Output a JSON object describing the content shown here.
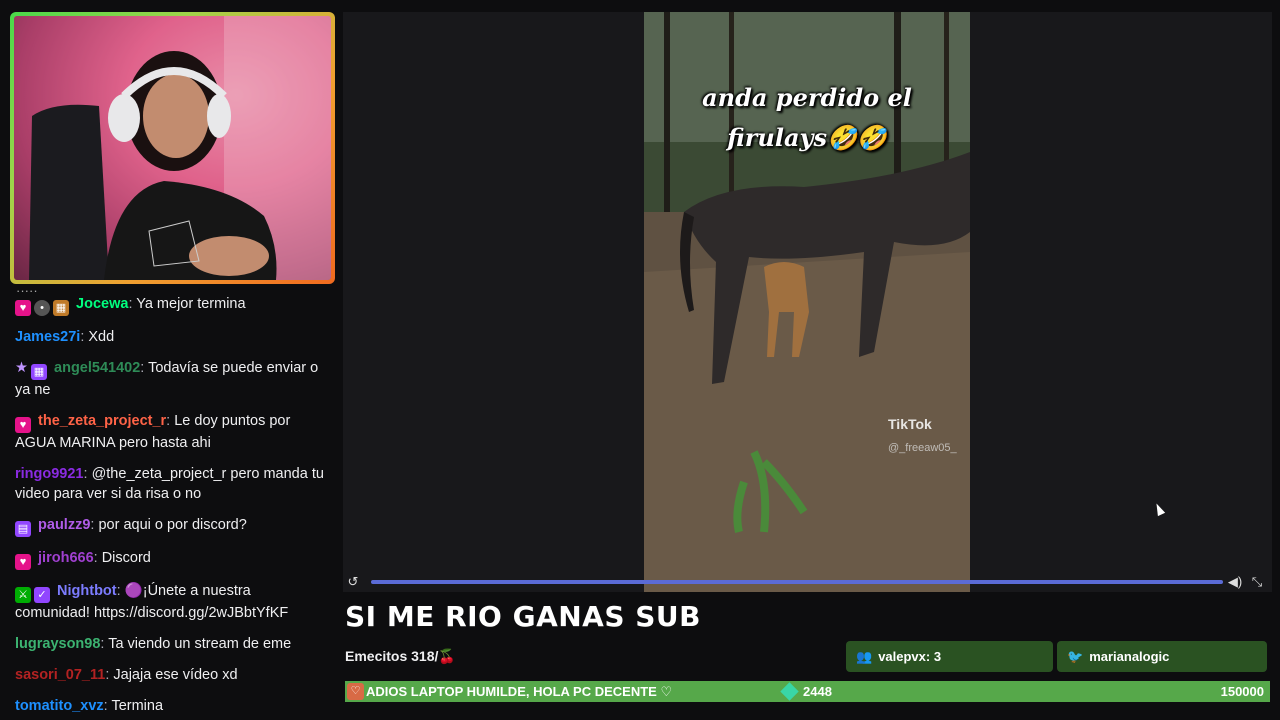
{
  "chat": {
    "messages": [
      {
        "user": "Jocewa",
        "color": "#00ff7f",
        "badges": [
          "heart",
          "mouse",
          "lock"
        ],
        "text": "Ya mejor termina"
      },
      {
        "user": "James27i",
        "color": "#1e90ff",
        "badges": [],
        "text": "Xdd"
      },
      {
        "user": "angel541402",
        "color": "#2e8b57",
        "badges": [
          "star",
          "grid"
        ],
        "text": "Todavía se puede enviar o ya ne"
      },
      {
        "user": "the_zeta_project_r",
        "color": "#ff6347",
        "badges": [
          "heart"
        ],
        "text": "Le doy puntos por AGUA MARINA pero hasta ahi"
      },
      {
        "user": "ringo9921",
        "color": "#8a2be2",
        "badges": [],
        "text": "@the_zeta_project_r pero manda tu video para ver si da risa o no"
      },
      {
        "user": "paulzz9",
        "color": "#b05ce8",
        "badges": [
          "twitch"
        ],
        "text": "por aqui o por discord?"
      },
      {
        "user": "jiroh666",
        "color": "#a040d0",
        "badges": [
          "heart"
        ],
        "text": "Discord"
      },
      {
        "user": "Nightbot",
        "color": "#7c7cff",
        "badges": [
          "mod",
          "verified"
        ],
        "text": "🟣¡Únete a nuestra comunidad! https://discord.gg/2wJBbtYfKF"
      },
      {
        "user": "lugrayson98",
        "color": "#3cb371",
        "badges": [],
        "text": "Ta viendo un stream de eme"
      },
      {
        "user": "sasori_07_11",
        "color": "#b22222",
        "badges": [],
        "text": "Jajaja ese vídeo xd"
      },
      {
        "user": "tomatito_xvz",
        "color": "#1e90ff",
        "badges": [],
        "text": "Termina"
      }
    ]
  },
  "video": {
    "caption_line1": "anda perdido el",
    "caption_line2": "firulays🤣🤣",
    "watermark": "TikTok",
    "handle": "@_freeaw05_",
    "progress": 1.0
  },
  "stream": {
    "title": "SI ME RIO GANAS SUB",
    "emecitos": "Emecitos 318/",
    "emecitos_icon": "🍒"
  },
  "pills": {
    "left": "valepvx: 3",
    "right": "marianalogic"
  },
  "goal": {
    "text": "ADIOS LAPTOP HUMILDE, HOLA PC DECENTE ♡",
    "current": "2448",
    "target": "150000",
    "progress": 0.016
  }
}
